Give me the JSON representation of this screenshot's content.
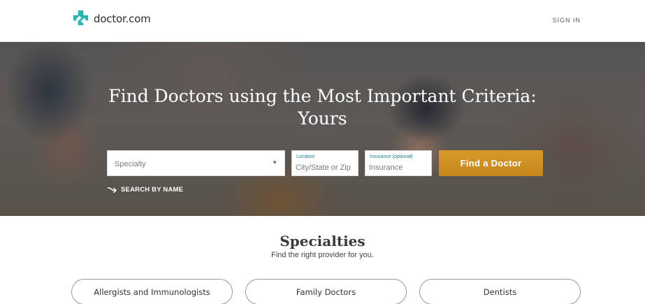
{
  "header": {
    "logo_text": "doctor.com",
    "logo_icon": "medical-cross-icon",
    "signin_label": "SIGN IN"
  },
  "hero": {
    "title_line1": "Find Doctors using the Most Important Criteria:",
    "title_line2": "Yours",
    "specialty_placeholder": "Specialty",
    "location_label": "Location",
    "location_placeholder": "City/State or Zip",
    "insurance_label": "Insurance (optional)",
    "insurance_placeholder": "Insurance",
    "find_button": "Find a Doctor",
    "search_by_name": "SEARCH BY NAME"
  },
  "specialties": {
    "title": "Specialties",
    "subtitle": "Find the right provider for you.",
    "items": [
      {
        "label": "Allergists and Immunologists"
      },
      {
        "label": "Family Doctors"
      },
      {
        "label": "Dentists"
      }
    ]
  },
  "colors": {
    "brand_teal": "#2bb3b1",
    "button_gold": "#d99a2b",
    "label_teal": "#1a7f8a"
  }
}
